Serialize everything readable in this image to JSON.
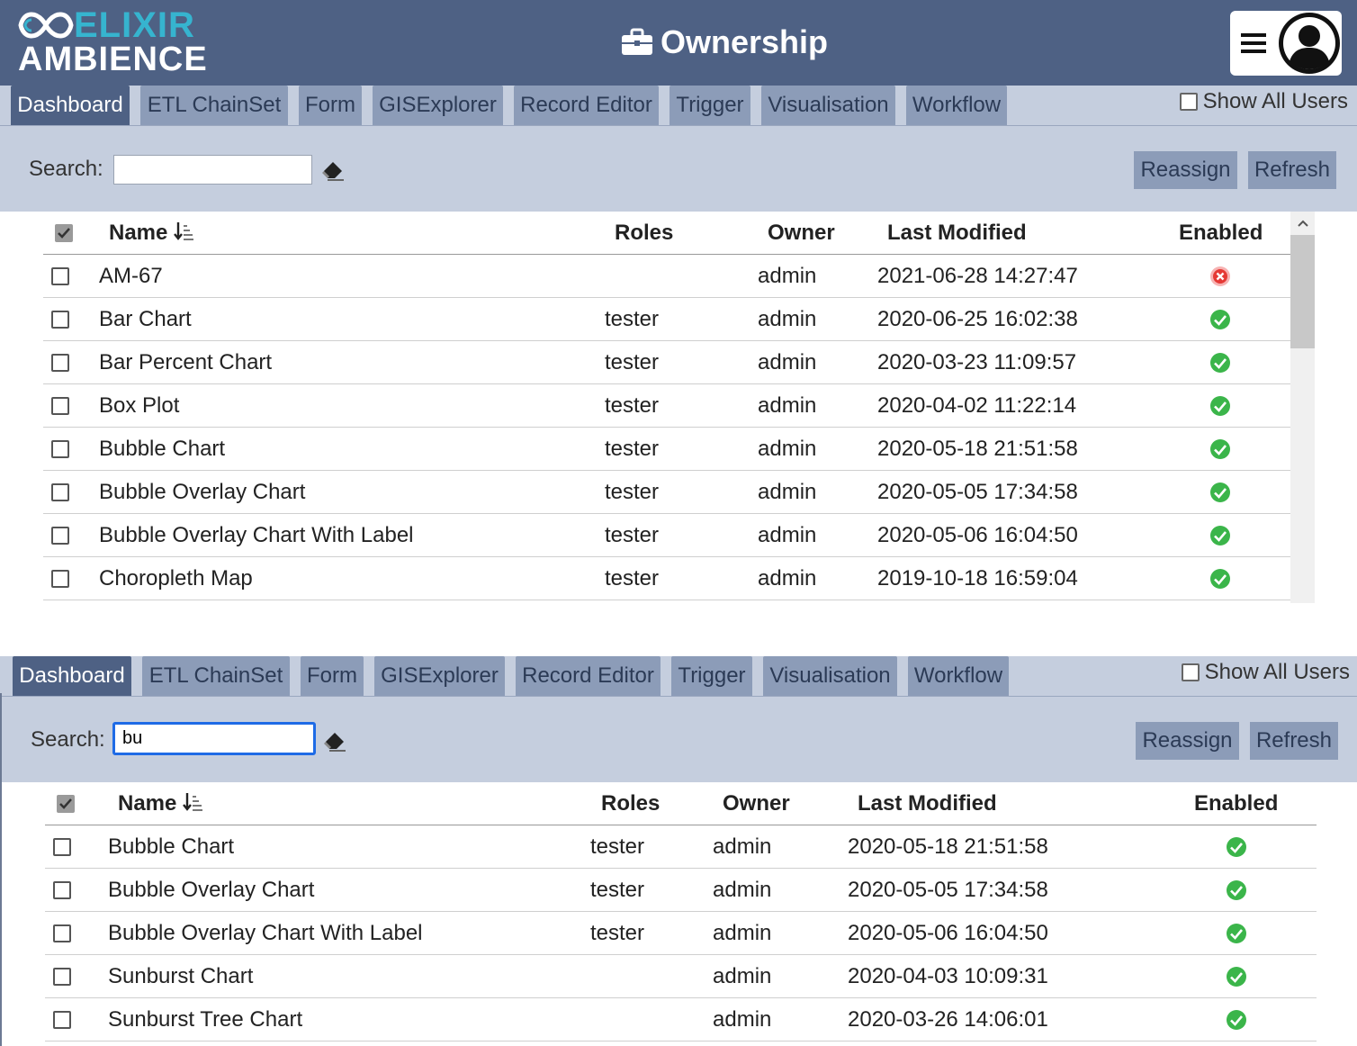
{
  "header": {
    "logo_line1": "ELIXIR",
    "logo_line2": "AMBIENCE",
    "title": "Ownership",
    "title_icon": "briefcase-icon",
    "menu_icon": "hamburger-icon",
    "avatar_icon": "user-avatar-icon"
  },
  "colors": {
    "header_bg": "#4e6184",
    "tab_bg": "#8c9cb8",
    "tab_active_bg": "#4e6184",
    "toolbar_bg": "#c5cede",
    "logo_accent": "#36b4cf",
    "enabled_green": "#3bb54a",
    "disabled_red": "#e53935"
  },
  "panels": [
    {
      "tabs": [
        {
          "label": "Dashboard"
        },
        {
          "label": "ETL ChainSet"
        },
        {
          "label": "Form"
        },
        {
          "label": "GISExplorer"
        },
        {
          "label": "Record Editor"
        },
        {
          "label": "Trigger"
        },
        {
          "label": "Visualisation"
        },
        {
          "label": "Workflow"
        }
      ],
      "active_tab": "Dashboard",
      "show_all_users": "Show All Users",
      "search_label": "Search:",
      "search_value": "",
      "reassign": "Reassign",
      "refresh": "Refresh",
      "columns": {
        "name": "Name",
        "roles": "Roles",
        "owner": "Owner",
        "modified": "Last Modified",
        "enabled": "Enabled"
      },
      "rows": [
        {
          "name": "AM-67",
          "roles": "",
          "owner": "admin",
          "modified": "2021-06-28 14:27:47",
          "enabled": false
        },
        {
          "name": "Bar Chart",
          "roles": "tester",
          "owner": "admin",
          "modified": "2020-06-25 16:02:38",
          "enabled": true
        },
        {
          "name": "Bar Percent Chart",
          "roles": "tester",
          "owner": "admin",
          "modified": "2020-03-23 11:09:57",
          "enabled": true
        },
        {
          "name": "Box Plot",
          "roles": "tester",
          "owner": "admin",
          "modified": "2020-04-02 11:22:14",
          "enabled": true
        },
        {
          "name": "Bubble Chart",
          "roles": "tester",
          "owner": "admin",
          "modified": "2020-05-18 21:51:58",
          "enabled": true
        },
        {
          "name": "Bubble Overlay Chart",
          "roles": "tester",
          "owner": "admin",
          "modified": "2020-05-05 17:34:58",
          "enabled": true
        },
        {
          "name": "Bubble Overlay Chart With Label",
          "roles": "tester",
          "owner": "admin",
          "modified": "2020-05-06 16:04:50",
          "enabled": true
        },
        {
          "name": "Choropleth Map",
          "roles": "tester",
          "owner": "admin",
          "modified": "2019-10-18 16:59:04",
          "enabled": true
        }
      ]
    },
    {
      "tabs": [
        {
          "label": "Dashboard"
        },
        {
          "label": "ETL ChainSet"
        },
        {
          "label": "Form"
        },
        {
          "label": "GISExplorer"
        },
        {
          "label": "Record Editor"
        },
        {
          "label": "Trigger"
        },
        {
          "label": "Visualisation"
        },
        {
          "label": "Workflow"
        }
      ],
      "active_tab": "Dashboard",
      "show_all_users": "Show All Users",
      "search_label": "Search:",
      "search_value": "bu",
      "reassign": "Reassign",
      "refresh": "Refresh",
      "columns": {
        "name": "Name",
        "roles": "Roles",
        "owner": "Owner",
        "modified": "Last Modified",
        "enabled": "Enabled"
      },
      "rows": [
        {
          "name": "Bubble Chart",
          "roles": "tester",
          "owner": "admin",
          "modified": "2020-05-18 21:51:58",
          "enabled": true
        },
        {
          "name": "Bubble Overlay Chart",
          "roles": "tester",
          "owner": "admin",
          "modified": "2020-05-05 17:34:58",
          "enabled": true
        },
        {
          "name": "Bubble Overlay Chart With Label",
          "roles": "tester",
          "owner": "admin",
          "modified": "2020-05-06 16:04:50",
          "enabled": true
        },
        {
          "name": "Sunburst Chart",
          "roles": "",
          "owner": "admin",
          "modified": "2020-04-03 10:09:31",
          "enabled": true
        },
        {
          "name": "Sunburst Tree Chart",
          "roles": "",
          "owner": "admin",
          "modified": "2020-03-26 14:06:01",
          "enabled": true
        }
      ]
    }
  ]
}
